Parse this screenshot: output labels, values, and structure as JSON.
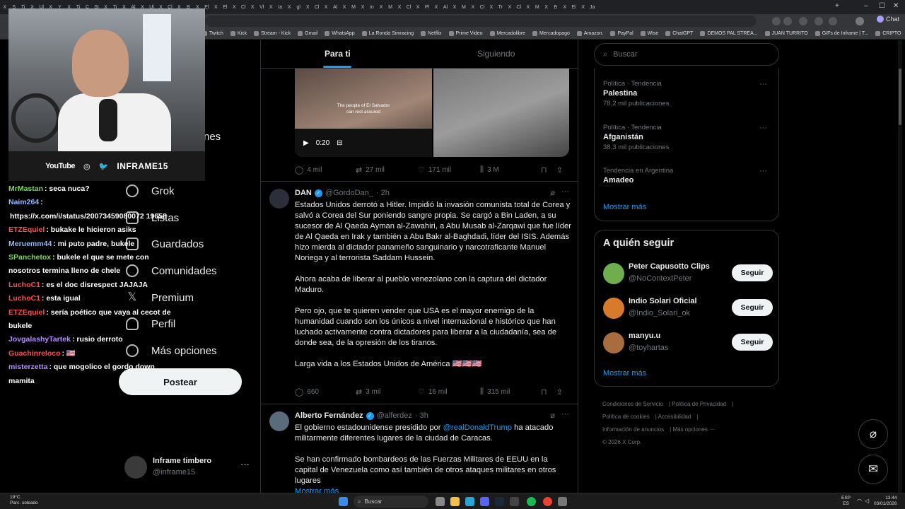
{
  "browser": {
    "tab_glyphs": [
      "X",
      "S",
      "Ti",
      "X",
      "Ul",
      "X",
      "Y",
      "X",
      "Ti",
      "C",
      "SI",
      "X",
      "Ti",
      "X",
      "Al",
      "X",
      "Ul",
      "X",
      "Cl",
      "X",
      "B",
      "X",
      "El",
      "X",
      "El",
      "X",
      "Cl",
      "X",
      "Vl",
      "X",
      "Ia",
      "X",
      "gl",
      "X",
      "Cl",
      "X",
      "Al",
      "X",
      "M",
      "X",
      "in",
      "X",
      "M",
      "X",
      "Cl",
      "X",
      "Pl",
      "X",
      "Al",
      "X",
      "M",
      "X",
      "Cl",
      "X",
      "Tr",
      "X",
      "Cl",
      "X",
      "M",
      "X",
      "B",
      "X",
      "Ei",
      "X",
      "Ja"
    ],
    "chat_button": "Chat",
    "bookmarks": [
      "Twitch",
      "Kick",
      "Stream - Kick",
      "Gmail",
      "WhatsApp",
      "La Ronda Simracing",
      "Netflix",
      "Prime Video",
      "Mercadolibre",
      "Mercadopago",
      "Amazon.",
      "PayPal",
      "Wise",
      "ChatGPT",
      "DEMOS PAL STREA...",
      "JUAN TURRITO",
      "GIFs de Inframe | T...",
      "CRIPTO",
      "aires"
    ]
  },
  "stream": {
    "youtube_label": "YouTube",
    "channel": "INFRAME15",
    "chat": [
      {
        "user": "MrMastan",
        "color": "#7bd65a",
        "text": ": seca nuca?"
      },
      {
        "user": "Naim264",
        "color": "#8fb7ff",
        "text": ":"
      },
      {
        "user": "",
        "color": "#ffffff",
        "text": "https://x.com/i/status/20073459080072 19658"
      },
      {
        "user": "ETZEquiel",
        "color": "#ff4d4d",
        "text": ": bukake le hicieron asiks"
      },
      {
        "user": "Meruemm44",
        "color": "#8fb7ff",
        "text": ": mi puto padre, bukele"
      },
      {
        "user": "SPanchetox",
        "color": "#7bd65a",
        "text": ": bukele el que se mete con nosotros termina lleno de chele"
      },
      {
        "user": "LuchoC1",
        "color": "#ff4d4d",
        "text": ": es el doc disrespect JAJAJA"
      },
      {
        "user": "LuchoC1",
        "color": "#ff4d4d",
        "text": ": esta igual"
      },
      {
        "user": "ETZEquiel",
        "color": "#ff4d4d",
        "text": ": sería poético que vaya al cecot de bukele"
      },
      {
        "user": "JovgalashyTartek",
        "color": "#b58cff",
        "text": ": rusio derroto"
      },
      {
        "user": "Guachinreloco",
        "color": "#ff4d4d",
        "text": ": 🇺🇸"
      },
      {
        "user": "misterzetta",
        "color": "#b58cff",
        "text": ": que mogolico el gordo down mamita"
      }
    ]
  },
  "nav": {
    "items": [
      "nes",
      "Grok",
      "Listas",
      "Guardados",
      "Comunidades",
      "Premium",
      "Perfil",
      "Más opciones"
    ],
    "post_button": "Postear",
    "profile_name": "Inframe timbero",
    "profile_handle": "@inframe15"
  },
  "feed": {
    "tabs": [
      "Para ti",
      "Siguiendo"
    ],
    "video": {
      "caption": "The people of El Salvador can rest assured",
      "time": "0:20"
    },
    "post0_stats": {
      "replies": "4 mil",
      "reposts": "27 mil",
      "likes": "171 mil",
      "views": "3 M"
    },
    "post1": {
      "name": "DAN",
      "handle": "@GordoDan_",
      "time": "· 2h",
      "text": "Estados Unidos derrotó a Hitler. Impidió la invasión comunista total de Corea y salvó a Corea del Sur poniendo sangre propia. Se cargó a Bin Laden, a su sucesor de Al Qaeda Ayman al-Zawahiri, a Abu Musab al-Zarqawi que fue líder de Al Qaeda en Irak y también a Abu Bakr al-Baghdadi, líder del ISIS. Además hizo mierda al dictador panameño sanguinario y narcotraficante Manuel Noriega y al terrorista Saddam Hussein.\n\nAhora acaba de liberar al pueblo venezolano con la captura del dictador Maduro.\n\nPero ojo, que te quieren vender que USA es el mayor enemigo de la humanidad cuando son los únicos a nivel internacional e histórico que han luchado activamente contra dictadores para liberar a la ciudadanía, sea de donde sea, de la opresión de los tiranos.\n\nLarga vida a los Estados Unidos de América 🇺🇸🇺🇸🇺🇸",
      "stats": {
        "replies": "660",
        "reposts": "3 mil",
        "likes": "16 mil",
        "views": "315 mil"
      }
    },
    "post2": {
      "name": "Alberto Fernández",
      "handle": "@alferdez",
      "time": "· 3h",
      "text_before": "El gobierno estadounidense presidido por ",
      "mention": "@realDonaldTrump",
      "text_after": " ha atacado militarmente diferentes lugares de la ciudad de Caracas.\n\nSe han confirmado bombardeos de las Fuerzas Militares de EEUU en la capital de Venezuela como así también de otros ataques militares en otros lugares",
      "show_more": "Mostrar más"
    }
  },
  "sidebar": {
    "search_placeholder": "Buscar",
    "trends": [
      {
        "category": "Política · Tendencia",
        "title": "Palestina",
        "count": "78,2 mil publicaciones"
      },
      {
        "category": "Política · Tendencia",
        "title": "Afganistán",
        "count": "38,3 mil publicaciones"
      },
      {
        "category": "Tendencia en Argentina",
        "title": "Amadeo",
        "count": ""
      }
    ],
    "trends_show_more": "Mostrar más",
    "who_to_follow_title": "A quién seguir",
    "follow": [
      {
        "name": "Peter Capusotto Clips",
        "handle": "@NoContextPeter",
        "button": "Seguir",
        "avatar_color": "#6fae4f"
      },
      {
        "name": "Indio Solari Oficial",
        "handle": "@Indio_Solari_ok",
        "button": "Seguir",
        "avatar_color": "#d77a2c"
      },
      {
        "name": "manyu.u",
        "handle": "@toyhartas",
        "button": "Seguir",
        "avatar_color": "#a86c3f"
      }
    ],
    "follow_show_more": "Mostrar más",
    "footer": [
      "Condiciones de Servicio",
      "Política de Privacidad",
      "Política de cookies",
      "Accesibilidad",
      "Información de anuncios",
      "Más opciones ···",
      "© 2026 X Corp."
    ]
  },
  "taskbar": {
    "weather_temp": "19°C",
    "weather_desc": "Parc. soleado",
    "search": "Buscar",
    "lang": "ESP",
    "lang_sub": "ES",
    "time": "13:44",
    "date": "03/01/2026"
  },
  "colors": {
    "accent": "#1d9bf0",
    "background": "#000000",
    "border": "#2f3336",
    "muted": "#71767b"
  }
}
